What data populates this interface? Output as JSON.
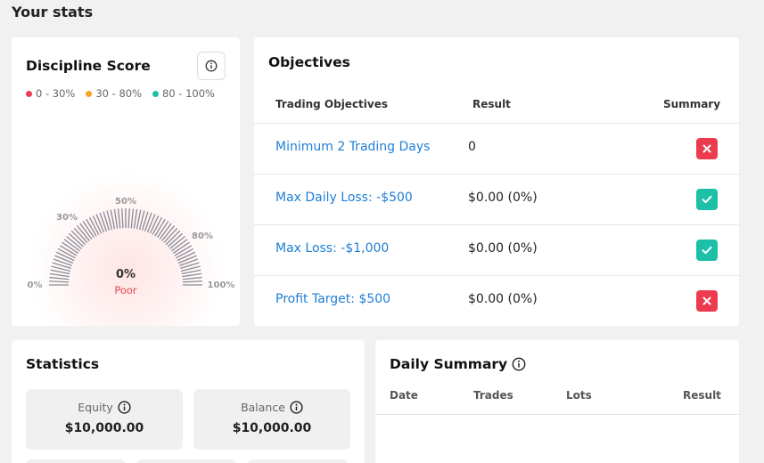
{
  "page": {
    "title": "Your stats"
  },
  "discipline": {
    "title": "Discipline Score",
    "legend": [
      {
        "label": "0 - 30%",
        "color": "#ec3b4f"
      },
      {
        "label": "30 - 80%",
        "color": "#f5a524"
      },
      {
        "label": "80 - 100%",
        "color": "#1dbfa7"
      }
    ],
    "gauge": {
      "value": "0%",
      "rating": "Poor",
      "ticks": [
        "0%",
        "30%",
        "50%",
        "80%",
        "100%"
      ],
      "level": 0
    },
    "icons": {
      "info": "info-icon"
    }
  },
  "objectives": {
    "title": "Objectives",
    "columns": {
      "objective": "Trading Objectives",
      "result": "Result",
      "summary": "Summary"
    },
    "rows": [
      {
        "name": "Minimum 2 Trading Days",
        "result": "0",
        "status": "fail"
      },
      {
        "name": "Max Daily Loss: -$500",
        "result": "$0.00 (0%)",
        "status": "pass"
      },
      {
        "name": "Max Loss: -$1,000",
        "result": "$0.00 (0%)",
        "status": "pass"
      },
      {
        "name": "Profit Target: $500",
        "result": "$0.00 (0%)",
        "status": "fail"
      }
    ]
  },
  "statistics": {
    "title": "Statistics",
    "items": [
      {
        "label": "Equity",
        "value": "$10,000.00"
      },
      {
        "label": "Balance",
        "value": "$10,000.00"
      }
    ]
  },
  "daily_summary": {
    "title": "Daily Summary",
    "columns": {
      "date": "Date",
      "trades": "Trades",
      "lots": "Lots",
      "result": "Result"
    }
  },
  "colors": {
    "link": "#1f7ed6",
    "fail": "#ec3b4f",
    "pass": "#1dbfa7",
    "gauge": "#8a8b97"
  }
}
